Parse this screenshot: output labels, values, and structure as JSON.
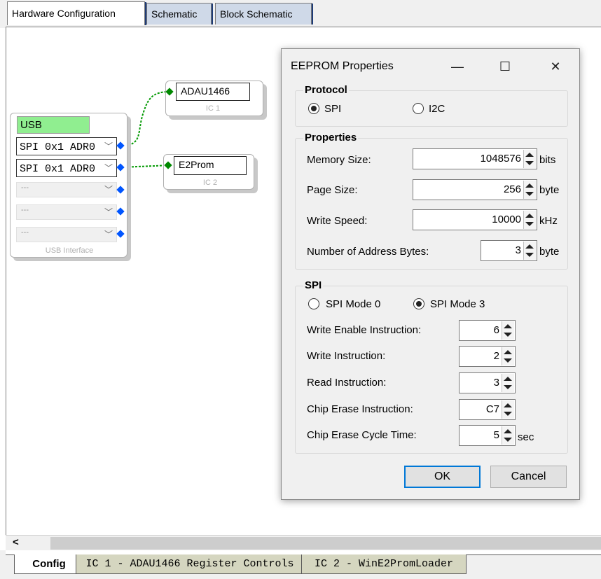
{
  "tabs": [
    "Hardware Configuration",
    "Schematic",
    "Block Schematic"
  ],
  "blocks": {
    "usb": {
      "title": "USB",
      "dropdowns": [
        "SPI 0x1 ADR0",
        "SPI 0x1 ADR0",
        "---",
        "---",
        "---"
      ],
      "caption": "USB Interface"
    },
    "ic1": {
      "name": "ADAU1466",
      "caption": "IC 1"
    },
    "ic2": {
      "name": "E2Prom",
      "caption": "IC 2"
    }
  },
  "dialog": {
    "title": "EEPROM Properties",
    "window_buttons": {
      "minimize": "—",
      "maximize": "☐",
      "close": "✕"
    },
    "protocol": {
      "label": "Protocol",
      "options": [
        "SPI",
        "I2C"
      ],
      "selected": "SPI"
    },
    "properties": {
      "label": "Properties",
      "fields": [
        {
          "label": "Memory Size:",
          "value": "1048576",
          "unit": "bits"
        },
        {
          "label": "Page Size:",
          "value": "256",
          "unit": "byte"
        },
        {
          "label": "Write Speed:",
          "value": "10000",
          "unit": "kHz"
        },
        {
          "label": "Number of Address Bytes:",
          "value": "3",
          "unit": "byte"
        }
      ]
    },
    "spi": {
      "label": "SPI",
      "modes": [
        "SPI Mode 0",
        "SPI Mode 3"
      ],
      "selected_mode": "SPI Mode 3",
      "fields": [
        {
          "label": "Write Enable Instruction:",
          "value": "6",
          "unit": ""
        },
        {
          "label": "Write Instruction:",
          "value": "2",
          "unit": ""
        },
        {
          "label": "Read Instruction:",
          "value": "3",
          "unit": ""
        },
        {
          "label": "Chip Erase Instruction:",
          "value": "C7",
          "unit": ""
        },
        {
          "label": "Chip Erase Cycle Time:",
          "value": "5",
          "unit": "sec"
        }
      ]
    },
    "ok_label": "OK",
    "cancel_label": "Cancel"
  },
  "scroll_left": "<",
  "bottom_tabs": [
    "Config",
    "IC 1 - ADAU1466 Register Controls",
    "IC 2 - WinE2PromLoader"
  ],
  "colors": {
    "usb_header": "#90ee90",
    "pin": "#0055ff",
    "wire": "#008800",
    "accent": "#0078d7"
  }
}
